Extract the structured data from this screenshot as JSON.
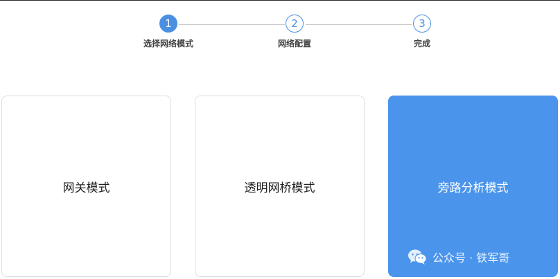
{
  "stepper": {
    "steps": [
      {
        "number": "1",
        "label": "选择网络模式",
        "state": "active"
      },
      {
        "number": "2",
        "label": "网络配置",
        "state": "pending"
      },
      {
        "number": "3",
        "label": "完成",
        "state": "pending"
      }
    ]
  },
  "modes": [
    {
      "label": "网关模式",
      "selected": false
    },
    {
      "label": "透明网桥模式",
      "selected": false
    },
    {
      "label": "旁路分析模式",
      "selected": true
    }
  ],
  "watermark": {
    "text": "公众号 · 铁军哥"
  },
  "colors": {
    "accent": "#4a90e2",
    "selected_card": "#4a94ec",
    "card_border": "#dedede"
  },
  "icons": {
    "watermark_icon": "wechat-icon"
  }
}
